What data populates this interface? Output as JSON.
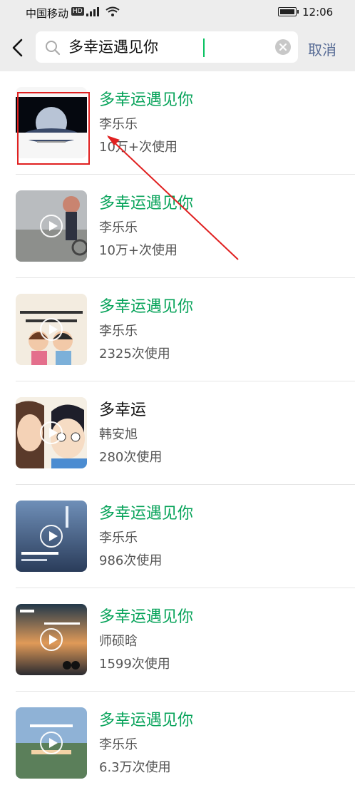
{
  "status_bar": {
    "carrier": "中国移动",
    "hd_badge": "HD",
    "time": "12:06"
  },
  "search": {
    "query": "多幸运遇见你",
    "cancel_label": "取消"
  },
  "results": [
    {
      "title": "多幸运遇见你",
      "artist": "李乐乐",
      "usage": "10万+次使用",
      "highlighted": true
    },
    {
      "title": "多幸运遇见你",
      "artist": "李乐乐",
      "usage": "10万+次使用",
      "highlighted": true
    },
    {
      "title": "多幸运遇见你",
      "artist": "李乐乐",
      "usage": "2325次使用",
      "highlighted": true
    },
    {
      "title": "多幸运",
      "artist": "韩安旭",
      "usage": "280次使用",
      "highlighted": false
    },
    {
      "title": "多幸运遇见你",
      "artist": "李乐乐",
      "usage": "986次使用",
      "highlighted": true
    },
    {
      "title": "多幸运遇见你",
      "artist": "师硕晗",
      "usage": "1599次使用",
      "highlighted": true
    },
    {
      "title": "多幸运遇见你",
      "artist": "李乐乐",
      "usage": "6.3万次使用",
      "highlighted": true
    }
  ],
  "colors": {
    "accent_green": "#07a35a",
    "link_blue": "#576b95",
    "annotation_red": "#e02020"
  }
}
